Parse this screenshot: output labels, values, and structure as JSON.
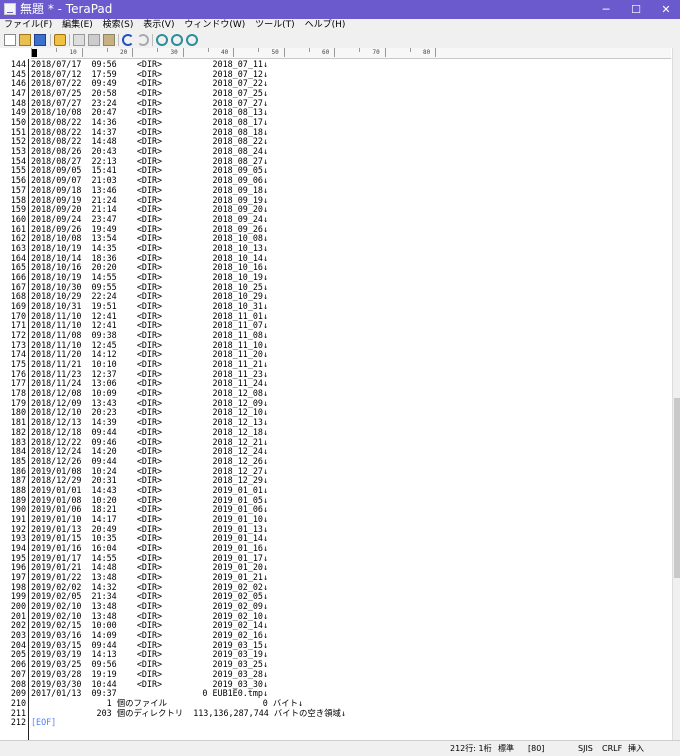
{
  "window": {
    "title": "無題 * - TeraPad",
    "minimize": "─",
    "maximize": "☐",
    "close": "✕"
  },
  "menu": [
    "ファイル(F)",
    "編集(E)",
    "検索(S)",
    "表示(V)",
    "ウィンドウ(W)",
    "ツール(T)",
    "ヘルプ(H)"
  ],
  "toolbar": [
    "new-file-icon",
    "open-folder-icon",
    "save-icon",
    "print-icon",
    "cut-icon",
    "copy-icon",
    "paste-icon",
    "undo-icon",
    "redo-icon",
    "find-icon",
    "find-next-icon",
    "find-prev-icon"
  ],
  "ruler": [
    "10",
    "20",
    "30",
    "40",
    "50",
    "60",
    "70",
    "80"
  ],
  "lines": [
    [
      "144",
      "2018/07/17  09:56    <DIR>          2018_07_11↓"
    ],
    [
      "145",
      "2018/07/12  17:59    <DIR>          2018_07_12↓"
    ],
    [
      "146",
      "2018/07/22  09:49    <DIR>          2018_07_22↓"
    ],
    [
      "147",
      "2018/07/25  20:58    <DIR>          2018_07_25↓"
    ],
    [
      "148",
      "2018/07/27  23:24    <DIR>          2018_07_27↓"
    ],
    [
      "149",
      "2018/10/08  20:47    <DIR>          2018_08_13↓"
    ],
    [
      "150",
      "2018/08/22  14:36    <DIR>          2018_08_17↓"
    ],
    [
      "151",
      "2018/08/22  14:37    <DIR>          2018_08_18↓"
    ],
    [
      "152",
      "2018/08/22  14:48    <DIR>          2018_08_22↓"
    ],
    [
      "153",
      "2018/08/26  20:43    <DIR>          2018_08_24↓"
    ],
    [
      "154",
      "2018/08/27  22:13    <DIR>          2018_08_27↓"
    ],
    [
      "155",
      "2018/09/05  15:41    <DIR>          2018_09_05↓"
    ],
    [
      "156",
      "2018/09/07  21:03    <DIR>          2018_09_06↓"
    ],
    [
      "157",
      "2018/09/18  13:46    <DIR>          2018_09_18↓"
    ],
    [
      "158",
      "2018/09/19  21:24    <DIR>          2018_09_19↓"
    ],
    [
      "159",
      "2018/09/20  21:14    <DIR>          2018_09_20↓"
    ],
    [
      "160",
      "2018/09/24  23:47    <DIR>          2018_09_24↓"
    ],
    [
      "161",
      "2018/09/26  19:49    <DIR>          2018_09_26↓"
    ],
    [
      "162",
      "2018/10/08  13:54    <DIR>          2018_10_08↓"
    ],
    [
      "163",
      "2018/10/19  14:35    <DIR>          2018_10_13↓"
    ],
    [
      "164",
      "2018/10/14  18:36    <DIR>          2018_10_14↓"
    ],
    [
      "165",
      "2018/10/16  20:20    <DIR>          2018_10_16↓"
    ],
    [
      "166",
      "2018/10/19  14:55    <DIR>          2018_10_19↓"
    ],
    [
      "167",
      "2018/10/30  09:55    <DIR>          2018_10_25↓"
    ],
    [
      "168",
      "2018/10/29  22:24    <DIR>          2018_10_29↓"
    ],
    [
      "169",
      "2018/10/31  19:51    <DIR>          2018_10_31↓"
    ],
    [
      "170",
      "2018/11/10  12:41    <DIR>          2018_11_01↓"
    ],
    [
      "171",
      "2018/11/10  12:41    <DIR>          2018_11_07↓"
    ],
    [
      "172",
      "2018/11/08  09:38    <DIR>          2018_11_08↓"
    ],
    [
      "173",
      "2018/11/10  12:45    <DIR>          2018_11_10↓"
    ],
    [
      "174",
      "2018/11/20  14:12    <DIR>          2018_11_20↓"
    ],
    [
      "175",
      "2018/11/21  10:10    <DIR>          2018_11_21↓"
    ],
    [
      "176",
      "2018/11/23  12:37    <DIR>          2018_11_23↓"
    ],
    [
      "177",
      "2018/11/24  13:06    <DIR>          2018_11_24↓"
    ],
    [
      "178",
      "2018/12/08  10:09    <DIR>          2018_12_08↓"
    ],
    [
      "179",
      "2018/12/09  13:43    <DIR>          2018_12_09↓"
    ],
    [
      "180",
      "2018/12/10  20:23    <DIR>          2018_12_10↓"
    ],
    [
      "181",
      "2018/12/13  14:39    <DIR>          2018_12_13↓"
    ],
    [
      "182",
      "2018/12/18  09:44    <DIR>          2018_12_18↓"
    ],
    [
      "183",
      "2018/12/22  09:46    <DIR>          2018_12_21↓"
    ],
    [
      "184",
      "2018/12/24  14:20    <DIR>          2018_12_24↓"
    ],
    [
      "185",
      "2018/12/26  09:44    <DIR>          2018_12_26↓"
    ],
    [
      "186",
      "2019/01/08  10:24    <DIR>          2018_12_27↓"
    ],
    [
      "187",
      "2018/12/29  20:31    <DIR>          2018_12_29↓"
    ],
    [
      "188",
      "2019/01/01  14:43    <DIR>          2019_01_01↓"
    ],
    [
      "189",
      "2019/01/08  10:20    <DIR>          2019_01_05↓"
    ],
    [
      "190",
      "2019/01/06  18:21    <DIR>          2019_01_06↓"
    ],
    [
      "191",
      "2019/01/10  14:17    <DIR>          2019_01_10↓"
    ],
    [
      "192",
      "2019/01/13  20:49    <DIR>          2019_01_13↓"
    ],
    [
      "193",
      "2019/01/15  10:35    <DIR>          2019_01_14↓"
    ],
    [
      "194",
      "2019/01/16  16:04    <DIR>          2019_01_16↓"
    ],
    [
      "195",
      "2019/01/17  14:55    <DIR>          2019_01_17↓"
    ],
    [
      "196",
      "2019/01/21  14:48    <DIR>          2019_01_20↓"
    ],
    [
      "197",
      "2019/01/22  13:48    <DIR>          2019_01_21↓"
    ],
    [
      "198",
      "2019/02/02  14:32    <DIR>          2019_02_02↓"
    ],
    [
      "199",
      "2019/02/05  21:34    <DIR>          2019_02_05↓"
    ],
    [
      "200",
      "2019/02/10  13:48    <DIR>          2019_02_09↓"
    ],
    [
      "201",
      "2019/02/10  13:48    <DIR>          2019_02_10↓"
    ],
    [
      "202",
      "2019/02/15  10:00    <DIR>          2019_02_14↓"
    ],
    [
      "203",
      "2019/03/16  14:09    <DIR>          2019_02_16↓"
    ],
    [
      "204",
      "2019/03/15  09:44    <DIR>          2019_03_15↓"
    ],
    [
      "205",
      "2019/03/19  14:13    <DIR>          2019_03_19↓"
    ],
    [
      "206",
      "2019/03/25  09:56    <DIR>          2019_03_25↓"
    ],
    [
      "207",
      "2019/03/28  19:19    <DIR>          2019_03_28↓"
    ],
    [
      "208",
      "2019/03/30  10:44    <DIR>          2019_03_30↓"
    ],
    [
      "209",
      "2017/01/13  09:37                 0 EUB1E0.tmp↓"
    ],
    [
      "210",
      "               1 個のファイル                   0 バイト↓"
    ],
    [
      "211",
      "             203 個のディレクトリ  113,136,287,744 バイトの空き領域↓"
    ],
    [
      "212",
      "[EOF]"
    ]
  ],
  "status": {
    "position": "212行:  1桁",
    "mode": "標準",
    "col": "[80]",
    "encoding": "SJIS",
    "linebreak": "CRLF",
    "insert": "挿入"
  }
}
